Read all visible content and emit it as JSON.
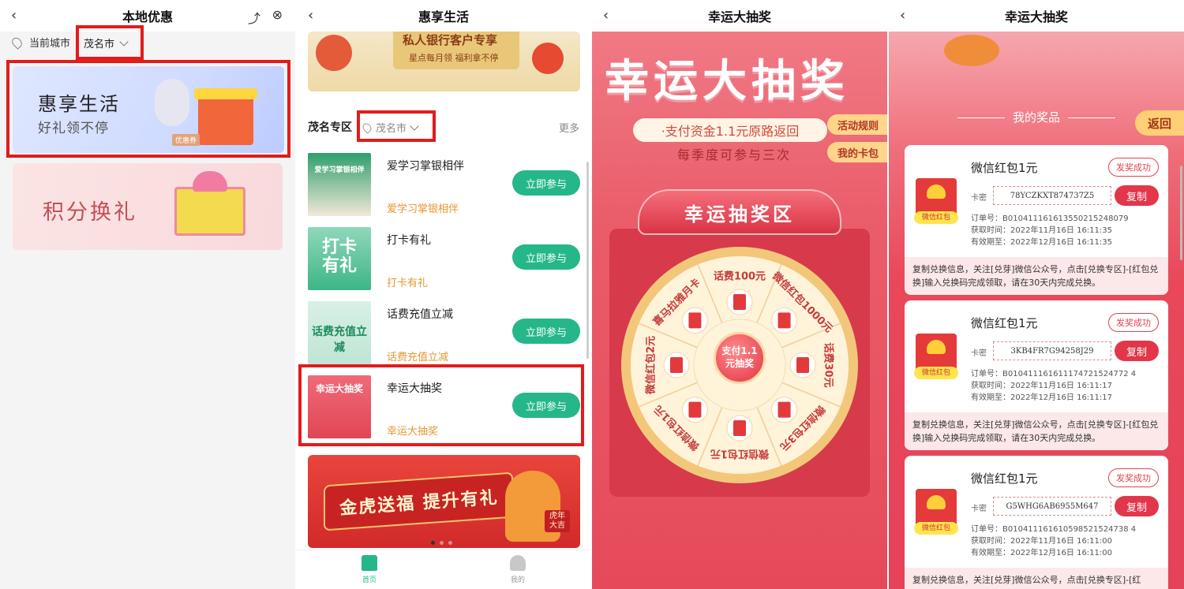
{
  "panel1": {
    "title": "本地优惠",
    "city_label": "当前城市",
    "city": "茂名市",
    "banner1_title": "惠享生活",
    "banner1_subtitle": "好礼领不停",
    "banner1_tag": "优惠券",
    "banner2_title": "积分换礼"
  },
  "panel2": {
    "title": "惠享生活",
    "top_banner_l1": "私人银行客户专享",
    "top_banner_l2": "星点每月领  福利拿不停",
    "zone_title": "茂名专区",
    "city": "茂名市",
    "more": "更多",
    "activities": [
      {
        "name": "爱学习掌银相伴",
        "sub": "爱学习掌银相伴",
        "btn": "立即参与",
        "thumb_text": "爱学习掌银相伴"
      },
      {
        "name": "打卡有礼",
        "sub": "打卡有礼",
        "btn": "立即参与",
        "thumb_text": "打卡有礼"
      },
      {
        "name": "话费充值立减",
        "sub": "话费充值立减",
        "btn": "立即参与",
        "thumb_text": "话费充值立减"
      },
      {
        "name": "幸运大抽奖",
        "sub": "幸运大抽奖",
        "btn": "立即参与",
        "thumb_text": "幸运大抽奖"
      }
    ],
    "tiger_banner": "金虎送福 提升有礼",
    "tiger_badge": "虎年大吉",
    "tabs": [
      {
        "label": "首页"
      },
      {
        "label": "我的"
      }
    ]
  },
  "panel3": {
    "title": "幸运大抽奖",
    "banner_title": "幸运大抽奖",
    "subtitle": "·支付资金1.1元原路返回",
    "subtitle2": "每季度可参与三次",
    "rules_btn": "活动规则",
    "mycards_btn": "我的卡包",
    "zone_title": "幸运抽奖区",
    "center_btn_l1": "支付1.1",
    "center_btn_l2": "元抽奖",
    "segments": [
      "话费100元",
      "微信红包1000元",
      "话费30元",
      "微信红包3元",
      "微信红包1元",
      "微信红包1元",
      "微信红包2元",
      "喜马拉雅月卡"
    ]
  },
  "panel4": {
    "title": "幸运大抽奖",
    "heading": "我的奖品",
    "back_btn": "返回",
    "prizes": [
      {
        "name": "微信红包1元",
        "status": "发奖成功",
        "icon_label": "微信红包",
        "key_label": "卡密",
        "key": "78YCZKXT874737Z5",
        "copy": "复制",
        "order": "订单号：B010411161613550215248079",
        "got": "获取时间：2022年11月16日 16:11:35",
        "valid": "有效期至：2022年12月16日 16:11:35",
        "note": "复制兑换信息，关注[兑芽]微信公众号，点击[兑换专区]-[红包兑换]输入兑换码完成领取，请在30天内完成兑换。"
      },
      {
        "name": "微信红包1元",
        "status": "发奖成功",
        "icon_label": "微信红包",
        "key_label": "卡密",
        "key": "3KB4FR7G94258J29",
        "copy": "复制",
        "order": "订单号：B010411161611174721524772 4",
        "got": "获取时间：2022年11月16日 16:11:17",
        "valid": "有效期至：2022年12月16日 16:11:17",
        "note": "复制兑换信息，关注[兑芽]微信公众号，点击[兑换专区]-[红包兑换]输入兑换码完成领取，请在30天内完成兑换。"
      },
      {
        "name": "微信红包1元",
        "status": "发奖成功",
        "icon_label": "微信红包",
        "key_label": "卡密",
        "key": "G5WHG6AB6955M647",
        "copy": "复制",
        "order": "订单号：B010411161610598521524738 4",
        "got": "获取时间：2022年11月16日 16:11:00",
        "valid": "有效期至：2022年12月16日 16:11:00",
        "note": "复制兑换信息，关注[兑芽]微信公众号，点击[兑换专区]-[红"
      }
    ]
  }
}
